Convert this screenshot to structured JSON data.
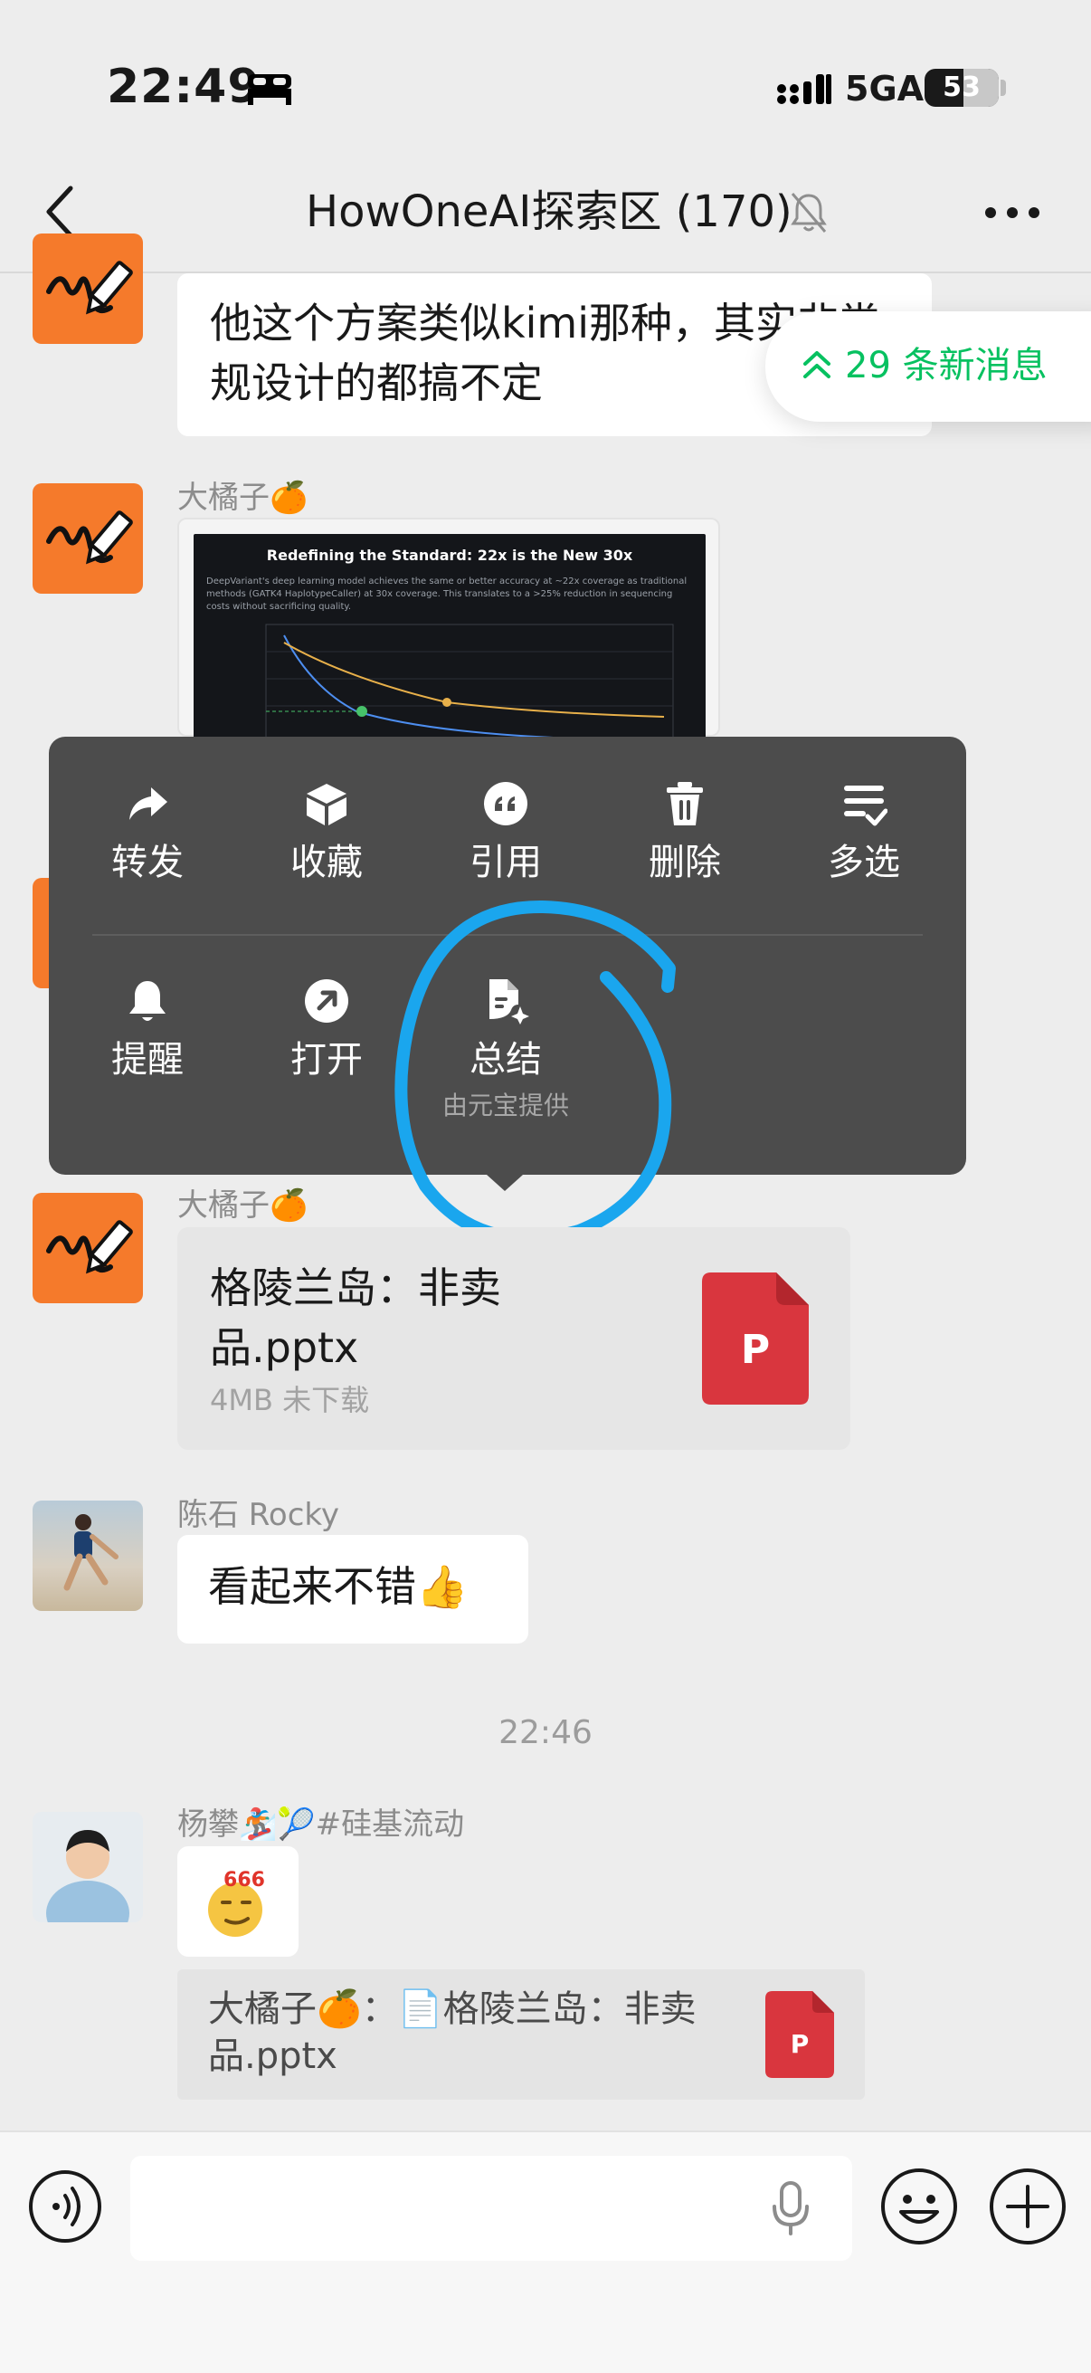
{
  "status_bar": {
    "time": "22:49",
    "network": "5GA",
    "battery": "53",
    "battery_level": 0.53
  },
  "header": {
    "title": "HowOneAI探索区 (170)"
  },
  "new_messages_pill": {
    "label": "29 条新消息"
  },
  "messages": {
    "m1_text": "他这个方案类似kimi那种，其实非常规设计的都搞不定",
    "m2_sender": "大橘子🍊",
    "m2_slide_title": "Redefining the Standard: 22x is the New 30x",
    "m2_slide_desc": "DeepVariant's deep learning model achieves the same or better accuracy at ~22x coverage as traditional methods (GATK4 HaplotypeCaller) at 30x coverage. This translates to a >25% reduction in sequencing costs without sacrificing quality.",
    "m3_sender": "大橘子🍊",
    "m3_file_name": "格陵兰岛：非卖品.pptx",
    "m3_file_meta": "4MB   未下载",
    "m3_file_badge": "P",
    "m4_sender": "陈石 Rocky",
    "m4_text": "看起来不错👍",
    "timestamp": "22:46",
    "m5_sender": "杨攀🏂🎾#硅基流动",
    "m5_sticker_text": "666",
    "m5_quote": "大橘子🍊：📄格陵兰岛：非卖品.pptx",
    "m5_quote_badge": "P"
  },
  "context_menu": {
    "items": [
      {
        "label": "转发",
        "icon": "forward-icon"
      },
      {
        "label": "收藏",
        "icon": "favorite-icon"
      },
      {
        "label": "引用",
        "icon": "quote-icon"
      },
      {
        "label": "删除",
        "icon": "delete-icon"
      },
      {
        "label": "多选",
        "icon": "multi-select-icon"
      },
      {
        "label": "提醒",
        "icon": "remind-icon"
      },
      {
        "label": "打开",
        "icon": "open-icon"
      },
      {
        "label": "总结",
        "icon": "summarize-icon",
        "sublabel": "由元宝提供"
      }
    ]
  },
  "colors": {
    "accent_green": "#07c160",
    "menu_bg": "#4c4c4c",
    "annotation_blue": "#1aa6ee",
    "ppt_red": "#d9363e",
    "avatar_orange": "#f57a2b"
  }
}
